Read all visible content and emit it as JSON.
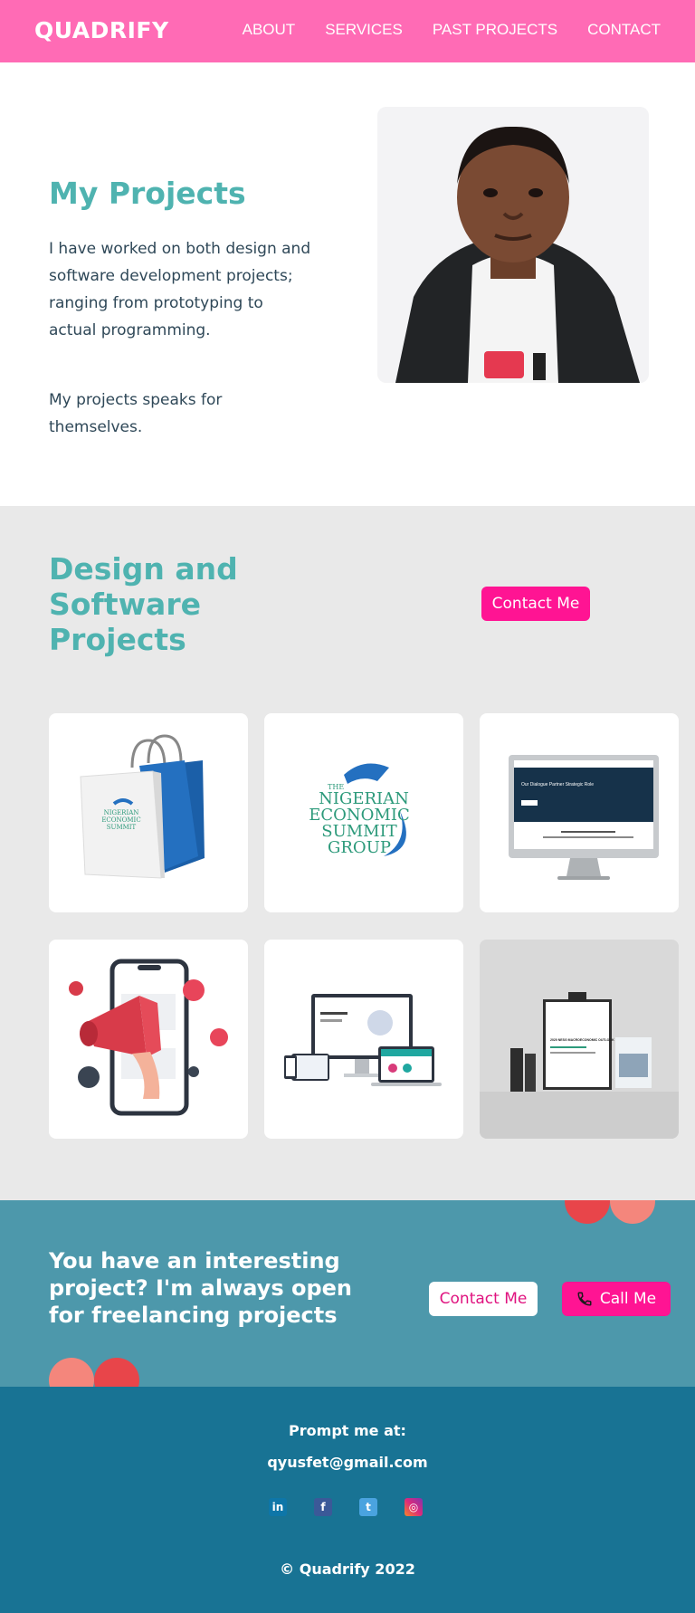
{
  "brand": "QUADRIFY",
  "nav": {
    "items": [
      {
        "label": "ABOUT"
      },
      {
        "label": "SERVICES"
      },
      {
        "label": "PAST PROJECTS"
      },
      {
        "label": "CONTACT"
      }
    ]
  },
  "hero": {
    "title": "My Projects",
    "paragraph1": "I have worked on both design and software development projects; ranging from prototyping to actual programming.",
    "paragraph2": "My projects speaks for themselves."
  },
  "projects": {
    "title": "Design and Software Projects",
    "contact_label": "Contact Me",
    "logo_lines": [
      "THE",
      "NIGERIAN",
      "ECONOMIC",
      "SUMMIT",
      "GROUP"
    ],
    "poster_title": "2020 NESG MACROECONOMIC OUTLOOK",
    "website_heading": "Our Dialogue Partner Strategic Role"
  },
  "cta": {
    "text": "You have an interesting project? I'm always open for freelancing projects",
    "contact_label": "Contact Me",
    "call_label": "Call Me"
  },
  "footer": {
    "prompt": "Prompt me at:",
    "email": "qyusfet@gmail.com",
    "socials": [
      {
        "icon": "linkedin-icon",
        "glyph": "in",
        "color": "#0e76a8"
      },
      {
        "icon": "facebook-icon",
        "glyph": "f",
        "color": "#3b5998"
      },
      {
        "icon": "twitter-icon",
        "glyph": "t",
        "color": "#4aa3df"
      },
      {
        "icon": "instagram-icon",
        "glyph": "◎",
        "color": "#c13584"
      }
    ],
    "copyright": "© Quadrify 2022"
  },
  "colors": {
    "nav_bg": "#ff6bb5",
    "accent": "#4fb3b0",
    "button": "#ff1493",
    "cta_bg": "#4d98ab",
    "footer_bg": "#187394",
    "projects_bg": "#e9e9e9"
  }
}
